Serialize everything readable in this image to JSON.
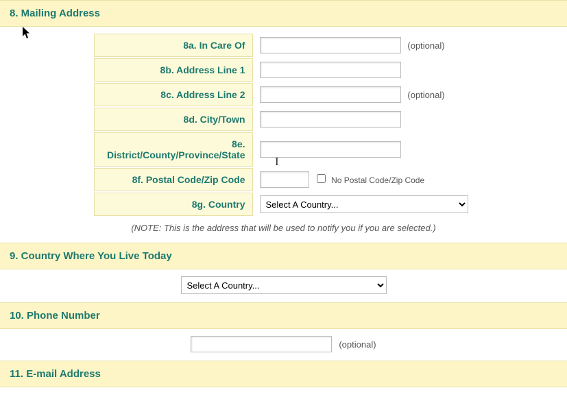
{
  "sections": {
    "mailing": {
      "title": "8. Mailing Address",
      "rows": {
        "care_of": {
          "label": "8a. In Care Of",
          "value": "",
          "optional": "(optional)"
        },
        "addr1": {
          "label": "8b. Address Line 1",
          "value": ""
        },
        "addr2": {
          "label": "8c. Address Line 2",
          "value": "",
          "optional": "(optional)"
        },
        "city": {
          "label": "8d. City/Town",
          "value": ""
        },
        "district": {
          "label": "8e. District/County/Province/State",
          "value": ""
        },
        "postal": {
          "label": "8f. Postal Code/Zip Code",
          "value": "",
          "checkbox_label": "No Postal Code/Zip Code",
          "checked": false
        },
        "country": {
          "label": "8g. Country",
          "selected": "Select A Country..."
        }
      },
      "note": "(NOTE: This is the address that will be used to notify you if you are selected.)"
    },
    "live_country": {
      "title": "9. Country Where You Live Today",
      "selected": "Select A Country..."
    },
    "phone": {
      "title": "10. Phone Number",
      "value": "",
      "optional": "(optional)"
    },
    "email": {
      "title": "11. E-mail Address"
    }
  }
}
